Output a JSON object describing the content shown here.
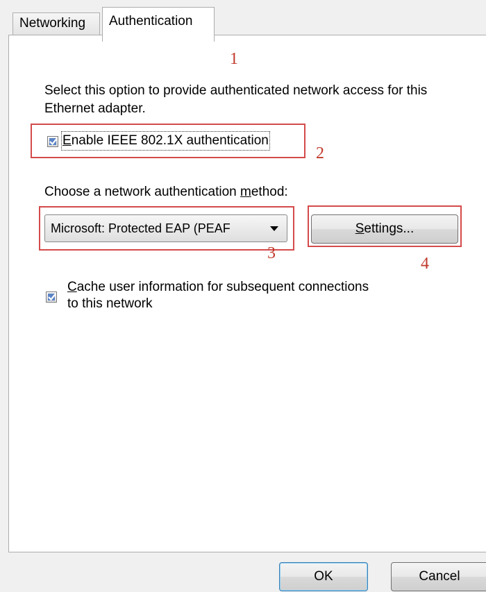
{
  "tabs": [
    {
      "label": "Networking",
      "active": false
    },
    {
      "label": "Authentication",
      "active": true
    }
  ],
  "description": "Select this option to provide authenticated network access for this Ethernet adapter.",
  "enable_auth": {
    "label_prefix": "",
    "mnemonic": "E",
    "label_rest": "nable IEEE 802.1X authentication",
    "checked": true
  },
  "method_label": {
    "before": "Choose a network authentication ",
    "mnemonic": "m",
    "after": "ethod:"
  },
  "method_select": {
    "value": "Microsoft: Protected EAP (PEAF"
  },
  "settings_button": {
    "mnemonic": "S",
    "rest": "ettings..."
  },
  "cache_info": {
    "mnemonic": "C",
    "label_rest": "ache user information for subsequent connections",
    "line2": "to this network",
    "checked": true
  },
  "annotations": [
    "1",
    "2",
    "3",
    "4"
  ],
  "footer": {
    "ok": "OK",
    "cancel": "Cancel"
  },
  "colors": {
    "annotation": "#d44a4a",
    "check_fill": "#5b84c4",
    "panel": "#ffffff",
    "window": "#f0f0f0"
  }
}
